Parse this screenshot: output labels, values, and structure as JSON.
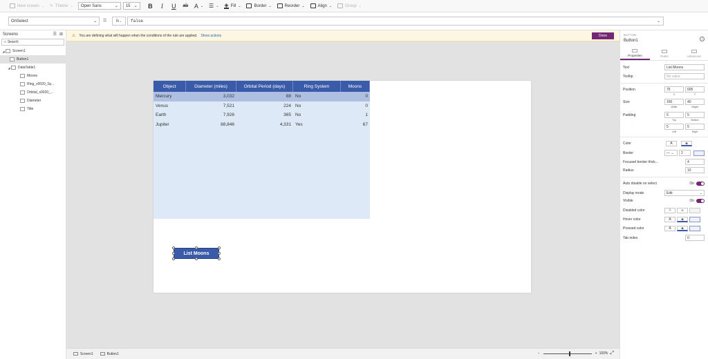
{
  "ribbon": {
    "new_screen": "New screen",
    "theme": "Theme",
    "font": "Open Sans",
    "font_size": "15",
    "bold": "B",
    "italic": "I",
    "underline": "U",
    "strike": "ab",
    "font_color": "A",
    "fill": "Fill",
    "border": "Border",
    "reorder": "Reorder",
    "align": "Align",
    "group": "Group"
  },
  "formula": {
    "property": "OnSelect",
    "equals": "=",
    "fx": "fx",
    "value": "false"
  },
  "tree": {
    "title": "Screens",
    "search_placeholder": "Search",
    "items": [
      {
        "label": "Screen1"
      },
      {
        "label": "Button1"
      },
      {
        "label": "DataTable1"
      },
      {
        "label": "Moons"
      },
      {
        "label": "Ring_x0020_Sy..."
      },
      {
        "label": "Orbital_x0020_..."
      },
      {
        "label": "Diameter"
      },
      {
        "label": "Title"
      }
    ]
  },
  "info_bar": {
    "message": "You are defining what will happen when the conditions of the rule are applied.",
    "link": "Show actions",
    "done": "Done"
  },
  "table": {
    "columns": [
      "Object",
      "Diameter (miles)",
      "Orbital Period (days)",
      "Ring System",
      "Moons"
    ],
    "rows": [
      [
        "Mercury",
        "3,032",
        "88",
        "No",
        "0"
      ],
      [
        "Venus",
        "7,521",
        "224",
        "No",
        "0"
      ],
      [
        "Earth",
        "7,926",
        "365",
        "No",
        "1"
      ],
      [
        "Jupiter",
        "88,846",
        "4,331",
        "Yes",
        "67"
      ]
    ]
  },
  "button": {
    "label": "List Moons"
  },
  "status": {
    "crumb_screen": "Screen1",
    "crumb_control": "Button1",
    "zoom_minus": "−",
    "zoom_plus": "+",
    "zoom": "100%"
  },
  "panel": {
    "type": "BUTTON",
    "name": "Button1",
    "tabs": [
      "Properties",
      "Rules",
      "Advanced"
    ],
    "text_label": "Text",
    "text_value": "List Moons",
    "tooltip_label": "Tooltip",
    "tooltip_placeholder": "No value",
    "position_label": "Position",
    "pos_x": "75",
    "pos_y": "605",
    "x_label": "X",
    "y_label": "Y",
    "size_label": "Size",
    "width": "160",
    "height": "40",
    "width_label": "Width",
    "height_label": "Height",
    "padding_label": "Padding",
    "pad_top": "5",
    "pad_bottom": "5",
    "pad_left": "5",
    "pad_right": "5",
    "top_label": "Top",
    "bottom_label": "Bottom",
    "left_label": "Left",
    "right_label": "Right",
    "color_label": "Color",
    "border_label": "Border",
    "border_width": "2",
    "focused_label": "Focused border thick...",
    "focused_value": "4",
    "radius_label": "Radius",
    "radius_value": "10",
    "auto_disable_label": "Auto disable on select",
    "auto_disable_value": "On",
    "display_mode_label": "Display mode",
    "display_mode_value": "Edit",
    "visible_label": "Visible",
    "visible_value": "On",
    "disabled_color_label": "Disabled color",
    "hover_color_label": "Hover color",
    "pressed_color_label": "Pressed color",
    "tab_index_label": "Tab index",
    "tab_index_value": "0"
  }
}
